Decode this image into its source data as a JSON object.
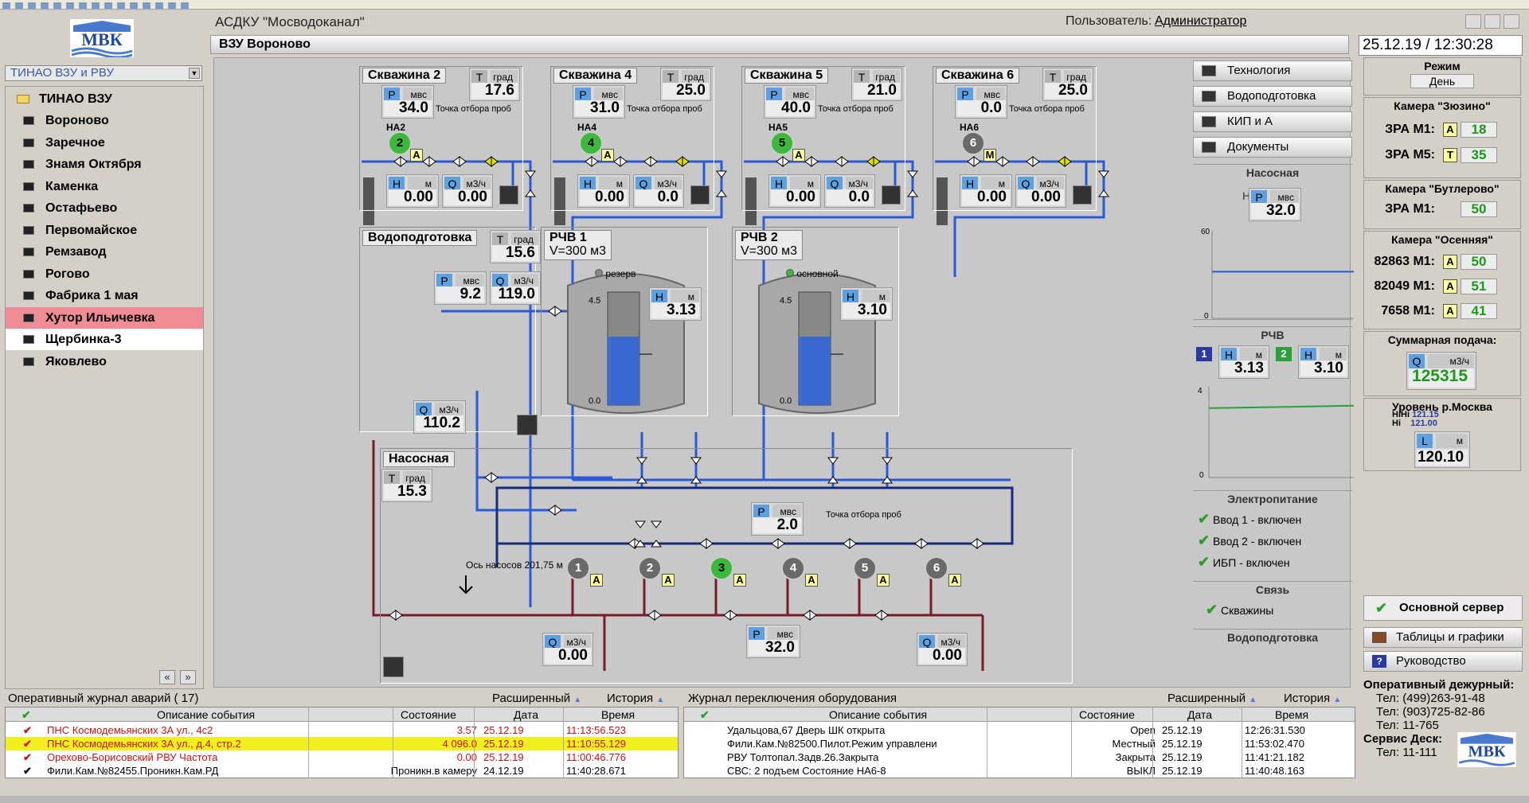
{
  "app": {
    "title": "АСДКУ \"Мосводоканал\"",
    "user_label": "Пользователь:",
    "user_name": "Администратор",
    "datetime": "25.12.19   / 12:30:28",
    "logo_text": "МВК"
  },
  "subtitle": "ВЗУ Вороново",
  "selector": {
    "value": "ТИНАО ВЗУ и РВУ"
  },
  "tree": {
    "root": "ТИНАО ВЗУ",
    "items": [
      "Вороново",
      "Заречное",
      "Знамя Октября",
      "Каменка",
      "Остафьево",
      "Первомайское",
      "Ремзавод",
      "Рогово",
      "Фабрика 1 мая",
      "Хутор Ильичевка",
      "Щербинка-3",
      "Яковлево"
    ]
  },
  "wells": [
    {
      "title": "Скважина 2",
      "na": "НА2",
      "pump": "2",
      "mode": "А",
      "t": "17.6",
      "p": "34.0",
      "h": "0.00",
      "q": "0.00"
    },
    {
      "title": "Скважина 4",
      "na": "НА4",
      "pump": "4",
      "mode": "А",
      "t": "25.0",
      "p": "31.0",
      "h": "0.00",
      "q": "0.0"
    },
    {
      "title": "Скважина 5",
      "na": "НА5",
      "pump": "5",
      "mode": "А",
      "t": "21.0",
      "p": "40.0",
      "h": "0.00",
      "q": "0.0"
    },
    {
      "title": "Скважина 6",
      "na": "НА6",
      "pump": "6",
      "mode": "М",
      "t": "25.0",
      "p": "0.0",
      "h": "0.00",
      "q": "0.00"
    }
  ],
  "labels": {
    "t": "Т",
    "p": "Р",
    "h": "Н",
    "q": "Q",
    "l": "L",
    "grad": "град",
    "mvs": "мвс",
    "m": "м",
    "m3h": "м3/ч",
    "sample": "Точка отбора проб",
    "axis": "Ось насосов 201,75 м",
    "max": "4.5",
    "min": "0.0"
  },
  "water_treatment": {
    "title": "Водоподготовка",
    "t": "15.6",
    "p": "9.2",
    "q": "119.0",
    "q_out": "110.2"
  },
  "tanks": [
    {
      "title": "РЧВ 1",
      "volume": "V=300 м3",
      "state": "резерв",
      "h": "3.13",
      "level_pct": 62
    },
    {
      "title": "РЧВ 2",
      "volume": "V=300 м3",
      "state": "основной",
      "h": "3.10",
      "level_pct": 62
    }
  ],
  "pump_station": {
    "title": "Насосная",
    "t": "15.3",
    "p_in": "2.0",
    "p_out": "32.0",
    "q_left": "0.00",
    "q_right": "0.00",
    "pumps": [
      {
        "n": "1",
        "on": false
      },
      {
        "n": "2",
        "on": false
      },
      {
        "n": "3",
        "on": true
      },
      {
        "n": "4",
        "on": false
      },
      {
        "n": "5",
        "on": false
      },
      {
        "n": "6",
        "on": false
      }
    ],
    "mode": "А"
  },
  "menu": [
    "Технология",
    "Водоподготовка",
    "КИП и А",
    "Документы"
  ],
  "side": {
    "nasosnaya": "Насосная",
    "napor_label": "Напор",
    "napor": "32.0",
    "chart1_max": "60",
    "chart1_min": "0",
    "rchv": "РЧВ",
    "rchv1": "3.13",
    "rchv2": "3.10",
    "chart2_max": "4",
    "chart2_min": "0",
    "power": "Электропитание",
    "power_items": [
      "Ввод 1 - включен",
      "Ввод 2 - включен",
      "ИБП - включен"
    ],
    "link": "Связь",
    "link_item": "Скважины",
    "wt": "Водоподготовка",
    "one": "1",
    "two": "2"
  },
  "right": {
    "mode_label": "Режим",
    "mode": "День",
    "cam1": {
      "title": "Камера \"Зюзино\"",
      "rows": [
        {
          "name": "ЗРА М1:",
          "mode": "А",
          "val": "18"
        },
        {
          "name": "ЗРА М5:",
          "mode": "Т",
          "val": "35"
        }
      ]
    },
    "cam2": {
      "title": "Камера \"Бутлерово\"",
      "rows": [
        {
          "name": "ЗРА М1:",
          "val": "50"
        }
      ]
    },
    "cam3": {
      "title": "Камера \"Осенняя\"",
      "rows": [
        {
          "name": "82863 М1:",
          "mode": "А",
          "val": "50"
        },
        {
          "name": "82049 М1:",
          "mode": "А",
          "val": "51"
        },
        {
          "name": "7658 М1:",
          "mode": "А",
          "val": "41"
        }
      ]
    },
    "sum_title": "Суммарная подача:",
    "sum": "125315",
    "river_title": "Уровень р.Москва",
    "hihi_l": "HiHi",
    "hihi": "121.15",
    "hi_l": "Hi",
    "hi": "121.00",
    "river": "120.10",
    "server": "Основной сервер",
    "tables": "Таблицы и графики",
    "guide": "Руководство",
    "q": "?"
  },
  "contacts": {
    "title": "Оперативный дежурный:",
    "phones": [
      "Тел: (499)263-91-48",
      "Тел: (903)725-82-86",
      "Тел: 11-765"
    ],
    "service": "Сервис Деск:",
    "service_phone": "Тел: 11-111"
  },
  "journal1": {
    "title": "Оперативный журнал аварий ( 17)",
    "ext": "Расширенный",
    "hist": "История",
    "cols": [
      "Описание события",
      "Состояние",
      "Дата",
      "Время"
    ],
    "rows": [
      {
        "desc": "ПНС Космодемьянских 3А ул., 4с2",
        "state": "3.57",
        "date": "25.12.19",
        "time": "11:13:56.523",
        "style": "red"
      },
      {
        "desc": "ПНС Космодемьянских 3А ул., д.4, стр.2",
        "state": "4 096.0",
        "date": "25.12.19",
        "time": "11:10:55.129",
        "style": "yellow"
      },
      {
        "desc": "Орехово-Борисовский РВУ Частота",
        "state": "0.00",
        "date": "25.12.19",
        "time": "11:00:46.776",
        "style": "red"
      },
      {
        "desc": "Фили.Кам.№82455.Проникн.Кам.РД",
        "state": "Проникн.в камеру",
        "date": "24.12.19",
        "time": "11:40:28.671",
        "style": "black"
      }
    ]
  },
  "journal2": {
    "title": "Журнал переключения оборудования",
    "ext": "Расширенный",
    "hist": "История",
    "cols": [
      "Описание события",
      "Состояние",
      "Дата",
      "Время"
    ],
    "rows": [
      {
        "desc": "Удальцова,67 Дверь ШК открыта",
        "state": "Open",
        "date": "25.12.19",
        "time": "12:26:31.530"
      },
      {
        "desc": "Фили.Кам.№82500.Пилот.Режим управлени",
        "state": "Местный",
        "date": "25.12.19",
        "time": "11:53:02.470"
      },
      {
        "desc": "РВУ Толтопал.Задв.26.Закрыта",
        "state": "Закрыта",
        "date": "25.12.19",
        "time": "11:41:21.182"
      },
      {
        "desc": "СВС: 2 подъем Состояние НА6-8",
        "state": "ВЫКЛ",
        "date": "25.12.19",
        "time": "11:40:48.163"
      }
    ]
  }
}
